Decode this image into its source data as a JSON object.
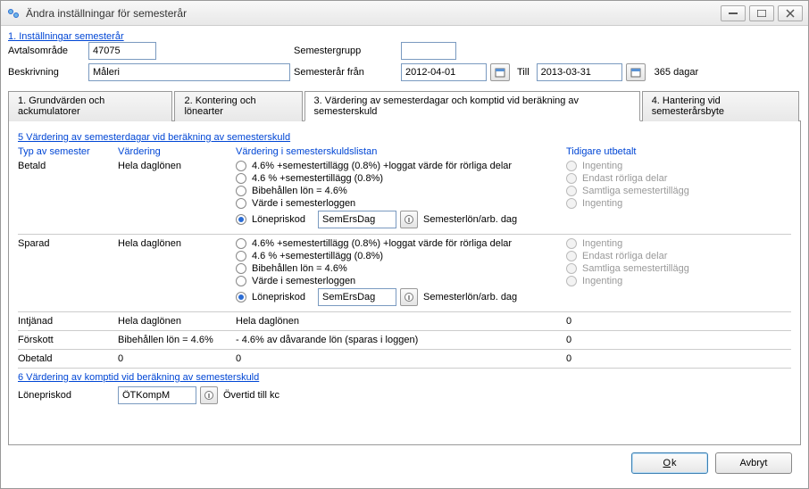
{
  "window": {
    "title": "Ändra inställningar för semesterår"
  },
  "section1": {
    "title": "1. Inställningar semesterår",
    "label_avtalsomrade": "Avtalsområde",
    "avtalsomrade": "47075",
    "label_beskrivning": "Beskrivning",
    "beskrivning": "Måleri",
    "label_semestergrupp": "Semestergrupp",
    "semestergrupp": "",
    "label_semesterar_fran": "Semesterår från",
    "fran": "2012-04-01",
    "label_till": "Till",
    "till": "2013-03-31",
    "days": "365 dagar"
  },
  "tabs": {
    "t1": "1. Grundvärden och ackumulatorer",
    "t2": "2. Kontering och lönearter",
    "t3": "3. Värdering av semesterdagar och komptid vid beräkning av semesterskuld",
    "t4": "4. Hantering vid semesterårsbyte"
  },
  "section5": {
    "title": "5 Värdering av semesterdagar vid beräkning av semesterskuld",
    "hdr_typ": "Typ av semester",
    "hdr_vard": "Värdering",
    "hdr_list": "Värdering i semesterskuldslistan",
    "hdr_tid": "Tidigare utbetalt",
    "betald": {
      "typ": "Betald",
      "vard": "Hela daglönen",
      "r1": "4.6% +semestertillägg (0.8%) +loggat värde för rörliga delar",
      "r2": "4.6 % +semestertillägg (0.8%)",
      "r3": "Bibehållen lön = 4.6%",
      "r4": "Värde i semesterloggen",
      "r5": "Lönepriskod",
      "lonepriskod": "SemErsDag",
      "perday": "Semesterlön/arb. dag",
      "t1": "Ingenting",
      "t2": "Endast rörliga delar",
      "t3": "Samtliga semestertillägg",
      "t4": "Ingenting"
    },
    "sparad": {
      "typ": "Sparad",
      "vard": "Hela daglönen",
      "r1": "4.6% +semestertillägg (0.8%) +loggat värde för rörliga delar",
      "r2": "4.6 % +semestertillägg (0.8%)",
      "r3": "Bibehållen lön = 4.6%",
      "r4": "Värde i semesterloggen",
      "r5": "Lönepriskod",
      "lonepriskod": "SemErsDag",
      "perday": "Semesterlön/arb. dag",
      "t1": "Ingenting",
      "t2": "Endast rörliga delar",
      "t3": "Samtliga semestertillägg",
      "t4": "Ingenting"
    },
    "intjanad": {
      "typ": "Intjänad",
      "vard": "Hela daglönen",
      "list": "Hela daglönen",
      "tid": "0"
    },
    "forskott": {
      "typ": "Förskott",
      "vard": "Bibehållen lön = 4.6%",
      "list": "- 4.6% av dåvarande lön (sparas i loggen)",
      "tid": "0"
    },
    "obetald": {
      "typ": "Obetald",
      "vard": "0",
      "list": "0",
      "tid": "0"
    }
  },
  "section6": {
    "title": "6 Värdering av komptid vid beräkning av semesterskuld",
    "label": "Lönepriskod",
    "code": "ÖTKompM",
    "desc": "Övertid till kc"
  },
  "footer": {
    "ok": "Ok",
    "cancel": "Avbryt"
  }
}
